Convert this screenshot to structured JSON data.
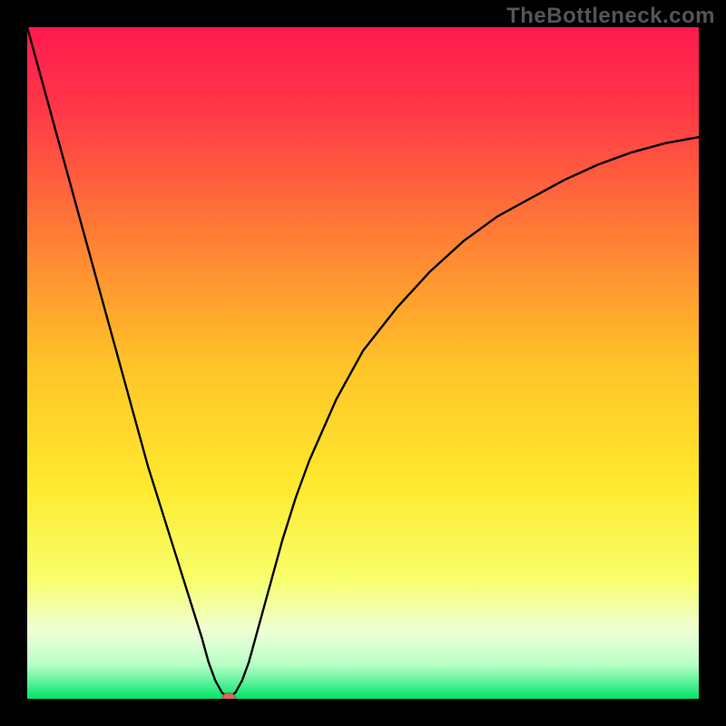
{
  "watermark": "TheBottleneck.com",
  "chart_data": {
    "type": "line",
    "title": "",
    "xlabel": "",
    "ylabel": "",
    "xlim": [
      0,
      100
    ],
    "ylim": [
      0,
      110
    ],
    "series": [
      {
        "name": "bottleneck-curve",
        "x": [
          0,
          2,
          4,
          6,
          8,
          10,
          12,
          14,
          16,
          18,
          20,
          22,
          24,
          26,
          27,
          28,
          29,
          30,
          31,
          32,
          33,
          34,
          36,
          38,
          40,
          42,
          44,
          46,
          48,
          50,
          55,
          60,
          65,
          70,
          75,
          80,
          85,
          90,
          95,
          100
        ],
        "y": [
          110,
          102,
          94,
          86,
          78,
          70,
          62,
          54,
          46,
          38,
          31,
          24,
          17,
          10,
          6,
          3,
          1,
          0.2,
          1,
          3,
          6,
          10,
          18,
          26,
          33,
          39,
          44,
          49,
          53,
          57,
          64,
          70,
          75,
          79,
          82,
          85,
          87.5,
          89.5,
          91,
          92
        ]
      }
    ],
    "marker": {
      "x": 30,
      "y": 0.2
    },
    "gradient_stops": [
      {
        "pct": 0,
        "color": "#ff1a4f"
      },
      {
        "pct": 12,
        "color": "#ff3747"
      },
      {
        "pct": 30,
        "color": "#ff7a36"
      },
      {
        "pct": 50,
        "color": "#ffc328"
      },
      {
        "pct": 68,
        "color": "#ffe92e"
      },
      {
        "pct": 82,
        "color": "#f8ff6a"
      },
      {
        "pct": 90,
        "color": "#eeffd6"
      },
      {
        "pct": 95,
        "color": "#b7ffc6"
      },
      {
        "pct": 100,
        "color": "#00e46a"
      }
    ]
  }
}
